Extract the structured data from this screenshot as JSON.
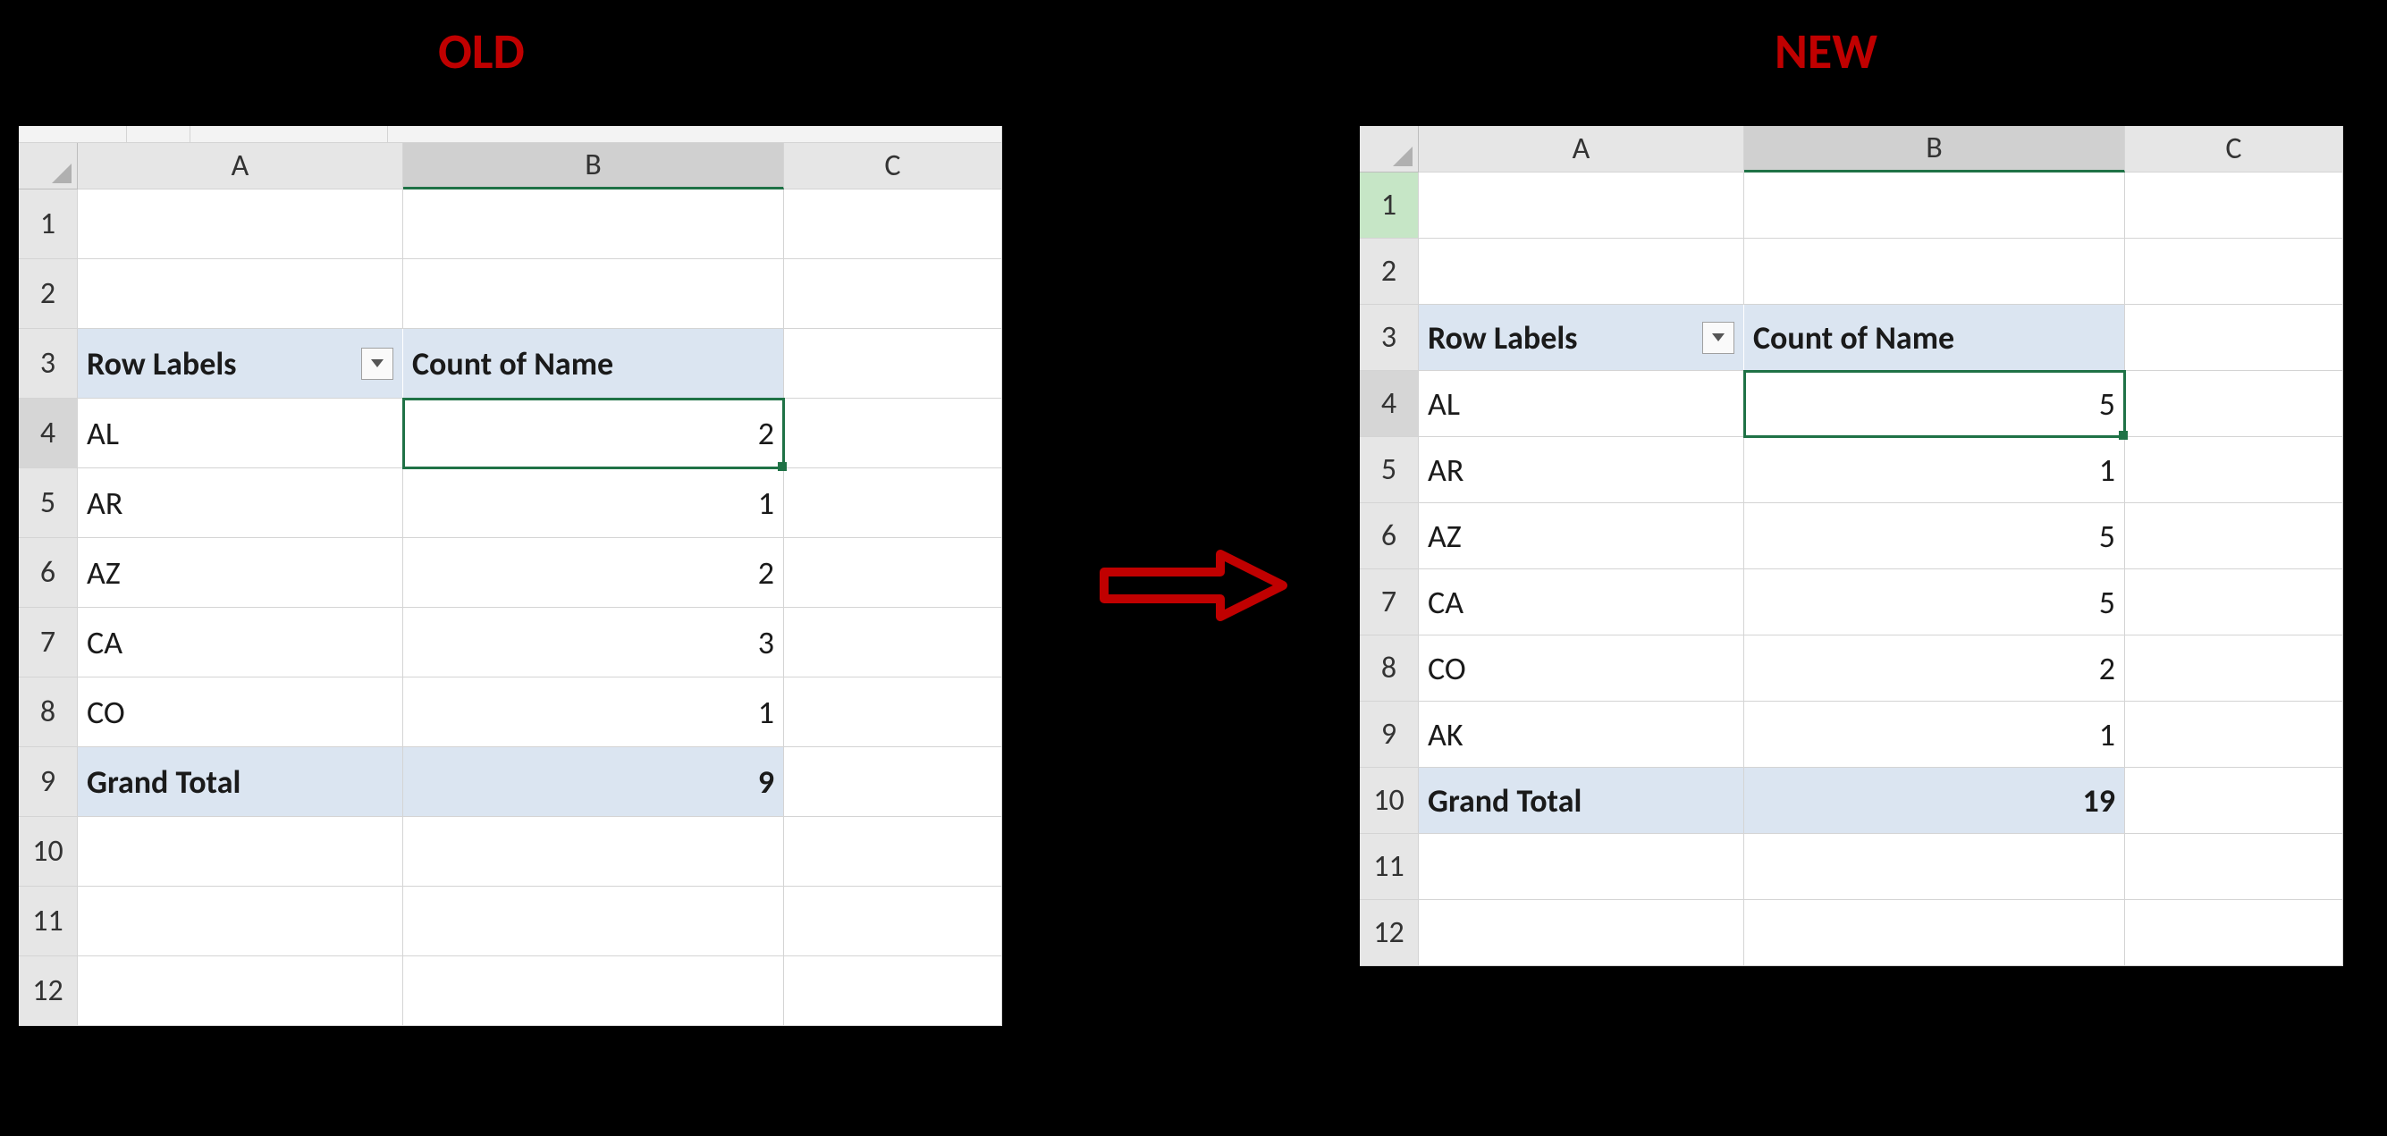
{
  "titles": {
    "old": "OLD",
    "new": "NEW"
  },
  "columns": [
    "A",
    "B",
    "C"
  ],
  "pivot_headers": {
    "row_labels": "Row Labels",
    "count": "Count of Name"
  },
  "grand_total_label": "Grand Total",
  "old": {
    "row_numbers": [
      "1",
      "2",
      "3",
      "4",
      "5",
      "6",
      "7",
      "8",
      "9",
      "10",
      "11",
      "12"
    ],
    "data": [
      {
        "label": "AL",
        "count": "2"
      },
      {
        "label": "AR",
        "count": "1"
      },
      {
        "label": "AZ",
        "count": "2"
      },
      {
        "label": "CA",
        "count": "3"
      },
      {
        "label": "CO",
        "count": "1"
      }
    ],
    "grand_total": "9",
    "active_row": "4",
    "selected_col": "B"
  },
  "new": {
    "row_numbers": [
      "1",
      "2",
      "3",
      "4",
      "5",
      "6",
      "7",
      "8",
      "9",
      "10",
      "11",
      "12"
    ],
    "data": [
      {
        "label": "AL",
        "count": "5"
      },
      {
        "label": "AR",
        "count": "1"
      },
      {
        "label": "AZ",
        "count": "5"
      },
      {
        "label": "CA",
        "count": "5"
      },
      {
        "label": "CO",
        "count": "2"
      },
      {
        "label": "AK",
        "count": "1"
      }
    ],
    "grand_total": "19",
    "active_row": "4",
    "selected_col": "B",
    "row1_highlight": true
  }
}
